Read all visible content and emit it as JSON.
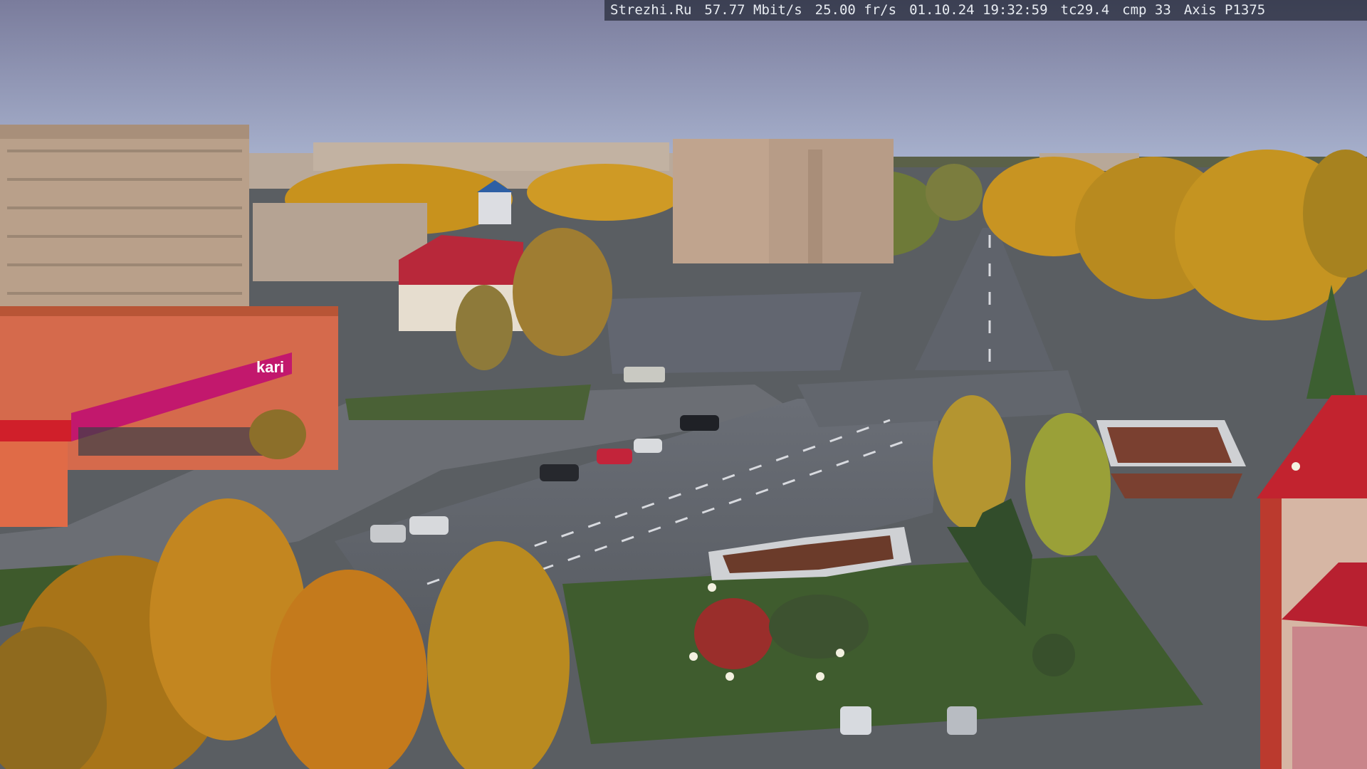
{
  "overlay": {
    "site": "Strezhi.Ru",
    "bitrate": "57.77 Mbit/s",
    "framerate": "25.00 fr/s",
    "datetime": "01.10.24 19:32:59",
    "tc": "tc29.4",
    "cmp": "cmp 33",
    "camera": "Axis P1375"
  },
  "signs": {
    "store_brand": "kari"
  },
  "colors": {
    "sky_top": "#7d7f9e",
    "sky_bottom": "#a6aecb",
    "asphalt": "#5c6068",
    "grass": "#3d5a2f",
    "autumn_gold": "#c8921d",
    "store_facade": "#d86a4a",
    "magenta_sign": "#c2186d",
    "tower_red": "#c2232f"
  }
}
